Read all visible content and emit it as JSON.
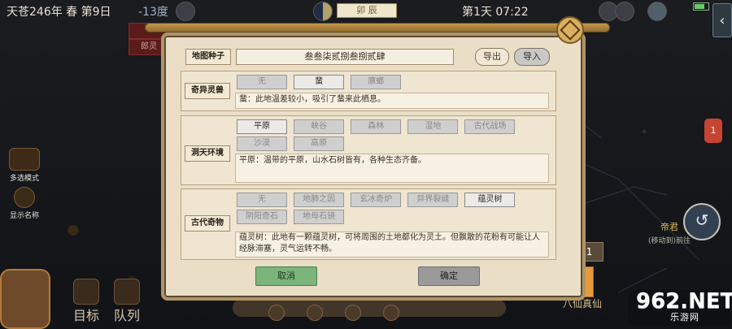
{
  "top": {
    "date": "天苍246年 春 第9日",
    "temp": "-13度",
    "chip": "卯 辰",
    "day_time": "第1天 07:22"
  },
  "left_hud": {
    "multi": "多选模式",
    "show": "显示名称"
  },
  "red_labels": [
    "",
    "郎灵"
  ],
  "modal": {
    "seed_label": "地图种子",
    "seed_value": "叁叁柒贰捌叁捌贰肆",
    "export": "导出",
    "import": "导入",
    "section_a": {
      "label": "奇异灵兽",
      "options": [
        "无",
        "蜚",
        "廪螂"
      ],
      "active_index": 1,
      "desc": "蜚：此地温差较小，吸引了蜚来此栖息。"
    },
    "section_b": {
      "label": "洞天环境",
      "options": [
        "平原",
        "峡谷",
        "森林",
        "湿地",
        "古代战场",
        "沙漠",
        "高原"
      ],
      "active_index": 0,
      "desc": "平原：温带的平原，山水石树皆有，各种生态齐备。"
    },
    "section_c": {
      "label": "古代奇物",
      "options": [
        "无",
        "地肺之因",
        "玄冰奇炉",
        "异界裂缝",
        "蕴灵树",
        "阴阳奇石",
        "地母石镜"
      ],
      "active_index": 4,
      "desc": "蕴灵树：此地有一颗蕴灵树，可将周围的土地都化为灵土。但飘散的花粉有可能让人经脉滞塞，灵气运转不畅。"
    },
    "cancel": "取消",
    "ok": "确定"
  },
  "bottom_nav": {
    "target": "目标",
    "team": "队列"
  },
  "right": {
    "emperor": "帝君",
    "emperor_sub": "(移动到)前往",
    "badge": "1",
    "bottom_right": "八仙真仙",
    "speed": "x1"
  },
  "watermark": {
    "num": "962.NET",
    "sub": "乐游网"
  }
}
